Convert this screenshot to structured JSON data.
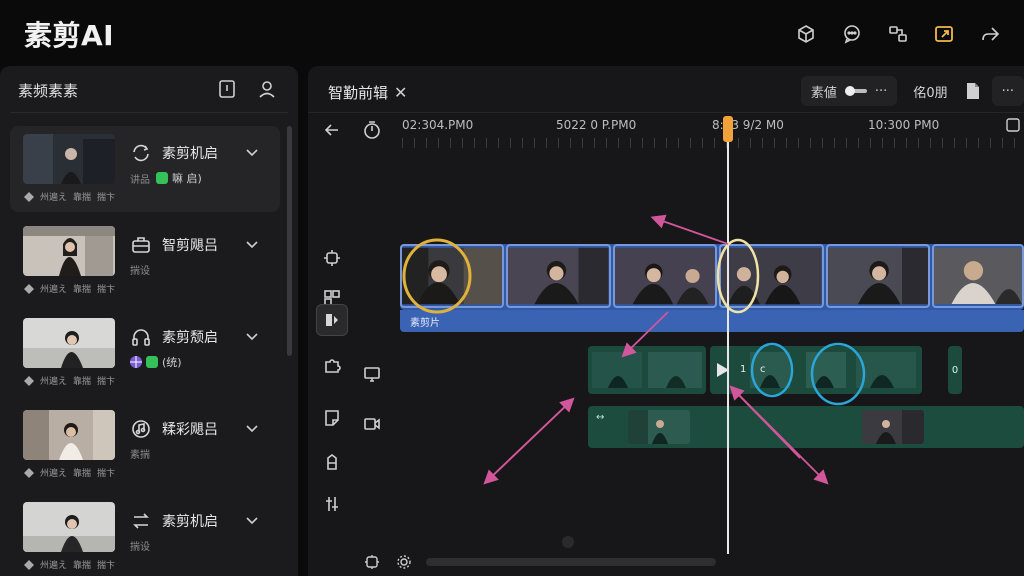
{
  "app": {
    "title": "素剪AI"
  },
  "top_icons": [
    "cube-icon",
    "chat-bubble-icon",
    "share-nodes-icon",
    "export-box-icon",
    "forward-arrow-icon"
  ],
  "top_accent": "#f2b84b",
  "left_panel": {
    "title": "素频素素",
    "items": [
      {
        "title": "素剪机启",
        "sub": "讲品",
        "tag": "嘛 启)",
        "tag_color": "#35c05a",
        "meta": [
          "州遍え",
          "靠揣",
          "揣卞"
        ],
        "icon": "refresh-text-icon"
      },
      {
        "title": "智剪飓吕",
        "sub": "揣设",
        "tag": "",
        "tag_color": "",
        "meta": [
          "州遍え",
          "靠揣",
          "揣卞"
        ],
        "icon": "briefcase-icon"
      },
      {
        "title": "素剪颓启",
        "sub": "",
        "tag": "(统)",
        "tag_color": "#35c05a",
        "meta": [
          "州遍え",
          "靠揣",
          "揣卞"
        ],
        "icon": "headphones-icon"
      },
      {
        "title": "糅彩飓吕",
        "sub": "素揣",
        "tag": "",
        "tag_color": "",
        "meta": [
          "州遍え",
          "靠揣",
          "揣卞"
        ],
        "icon": "music-note-icon"
      },
      {
        "title": "素剪机启",
        "sub": "揣设",
        "tag": "",
        "tag_color": "",
        "meta": [
          "州遍え",
          "靠揣",
          "揣卞"
        ],
        "icon": "swap-icon"
      }
    ]
  },
  "editor": {
    "tab_label": "智勤前辑",
    "close_label": "✕",
    "pill_label": "素値",
    "pill_more": "···",
    "btn_label": "佲0朋",
    "more_label": "···",
    "ruler": [
      "02:304.PM0",
      "5022 0 P.PM0",
      "8:23 9/2 M0",
      "10:300 PM0"
    ],
    "main_track_label": "素剪片",
    "teal_label": "↔",
    "mini_label": "0",
    "play_label": "▶",
    "teal_small_a": "1",
    "teal_small_b": "c"
  },
  "colors": {
    "main_track": "#2f5aa8",
    "teal_track": "#1c4a3d",
    "playhead_handle": "#f2a23a",
    "annotation_yellow": "#e0b23a",
    "annotation_cyan": "#2aa6d8",
    "annotation_pink": "#d2569b"
  }
}
